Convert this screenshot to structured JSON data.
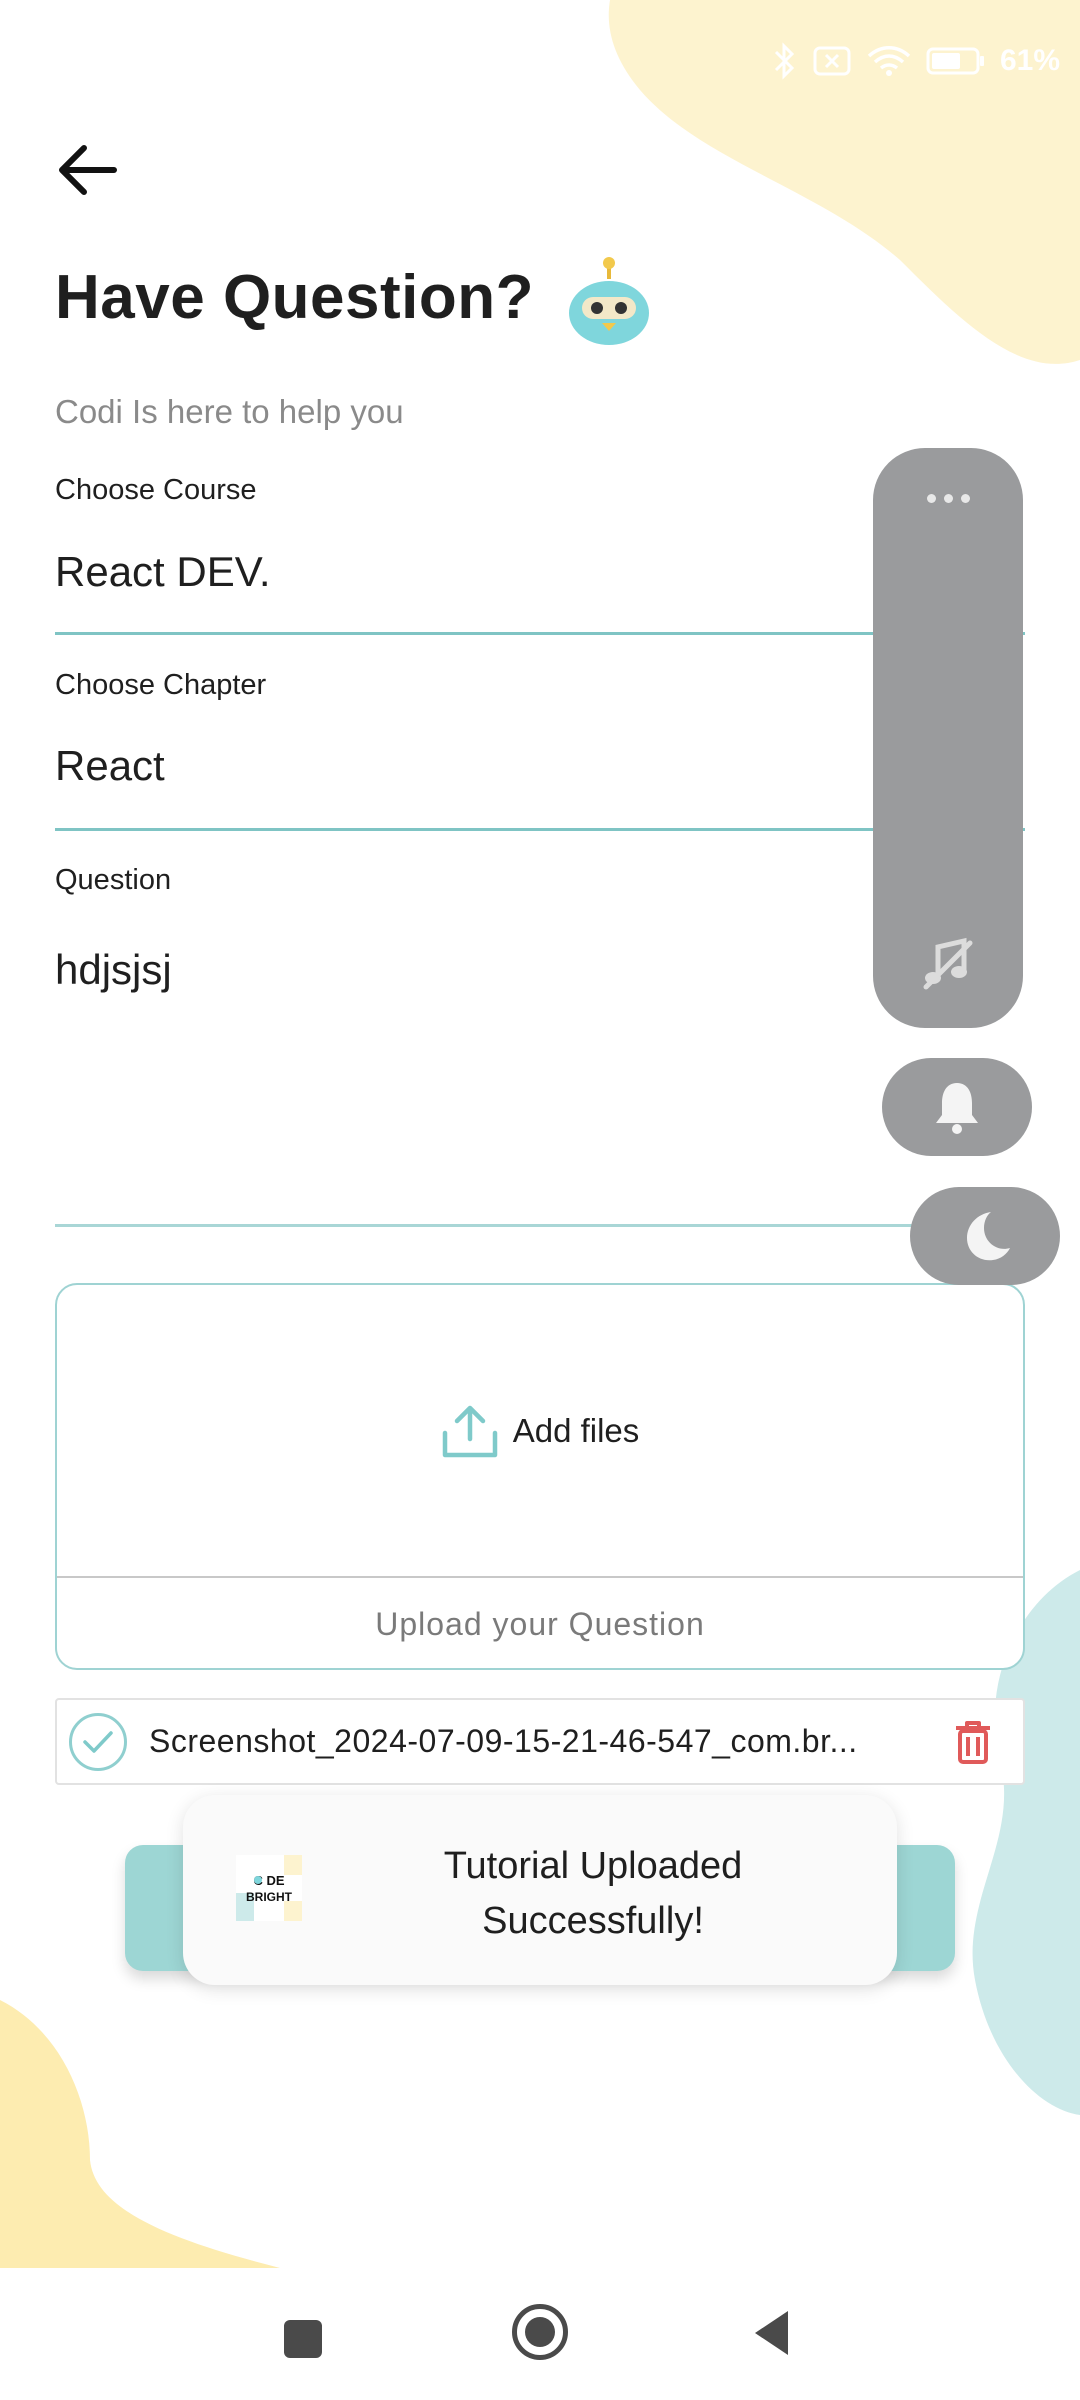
{
  "status_bar": {
    "battery": "61%"
  },
  "header": {
    "title": "Have Question?",
    "subtitle": "Codi Is here to help you"
  },
  "form": {
    "course_label": "Choose Course",
    "course_value": "React DEV.",
    "chapter_label": "Choose Chapter",
    "chapter_value": "React",
    "question_label": "Question",
    "question_value": "hdjsjsj"
  },
  "upload": {
    "add_files_label": "Add files",
    "caption": "Upload your Question"
  },
  "attachment": {
    "file_name": "Screenshot_2024-07-09-15-21-46-547_com.br..."
  },
  "toast": {
    "logo_text": "CODE BRIGHT",
    "message": "Tutorial Uploaded Successfully!"
  },
  "colors": {
    "accent": "#9dd6d4",
    "field_line": "#7fc4c4",
    "delete": "#e05a5a",
    "yellow_blob": "#fdf3cf",
    "teal_blob": "#cdeaea"
  },
  "icons": {
    "back": "arrow-left-icon",
    "robot": "robot-icon",
    "upload": "upload-icon",
    "check": "check-circle-icon",
    "delete": "trash-icon",
    "more": "more-dots-icon",
    "music_off": "music-off-icon",
    "bell": "bell-icon",
    "moon": "moon-icon"
  }
}
